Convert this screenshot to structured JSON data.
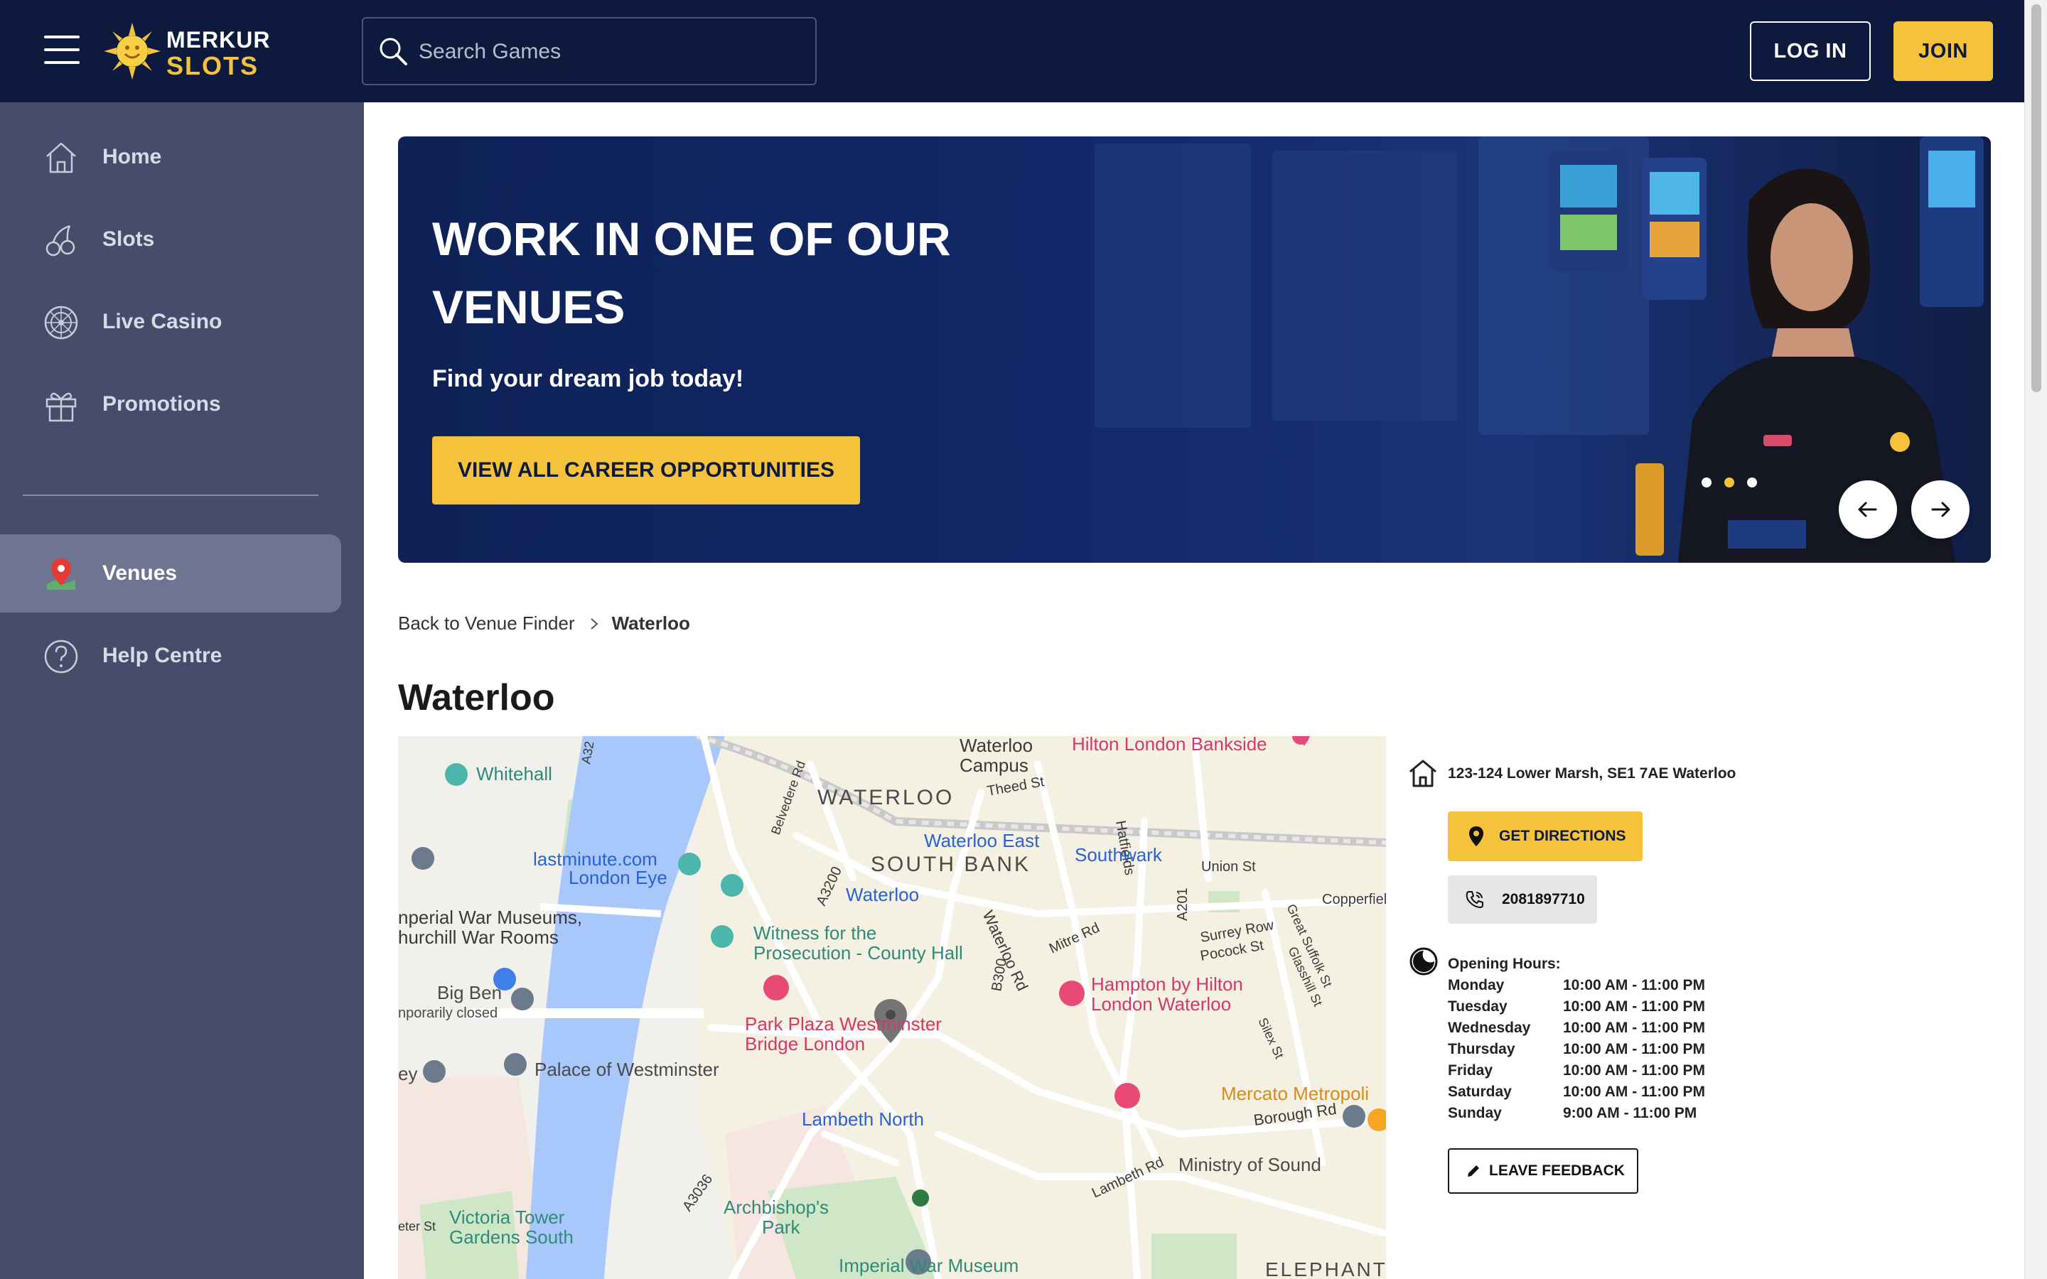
{
  "header": {
    "menu_icon": "hamburger-icon",
    "logo_line1": "MERKUR",
    "logo_line2": "SLOTS",
    "search_placeholder": "Search Games",
    "login_label": "LOG IN",
    "join_label": "JOIN"
  },
  "sidebar": {
    "items": [
      {
        "label": "Home",
        "icon": "home-icon"
      },
      {
        "label": "Slots",
        "icon": "cherries-icon"
      },
      {
        "label": "Live Casino",
        "icon": "roulette-wheel-icon"
      },
      {
        "label": "Promotions",
        "icon": "gift-icon"
      },
      {
        "label": "Venues",
        "icon": "map-pin-icon",
        "active": true
      },
      {
        "label": "Help Centre",
        "icon": "help-circle-icon"
      }
    ]
  },
  "banner": {
    "title_line1": "WORK IN ONE OF OUR",
    "title_line2": "VENUES",
    "subtitle": "Find your dream job today!",
    "cta_label": "VIEW ALL CAREER OPPORTUNITIES",
    "active_slide": 2,
    "slide_count": 3
  },
  "breadcrumb": {
    "back_label": "Back to Venue Finder",
    "current": "Waterloo"
  },
  "venue": {
    "title": "Waterloo",
    "address": "123-124 Lower Marsh, SE1 7AE Waterloo",
    "directions_label": "GET DIRECTIONS",
    "phone": "2081897710",
    "hours_title": "Opening Hours:",
    "hours": [
      {
        "day": "Monday",
        "time": "10:00 AM - 11:00 PM"
      },
      {
        "day": "Tuesday",
        "time": "10:00 AM - 11:00 PM"
      },
      {
        "day": "Wednesday",
        "time": "10:00 AM - 11:00 PM"
      },
      {
        "day": "Thursday",
        "time": "10:00 AM - 11:00 PM"
      },
      {
        "day": "Friday",
        "time": "10:00 AM - 11:00 PM"
      },
      {
        "day": "Saturday",
        "time": "10:00 AM - 11:00 PM"
      },
      {
        "day": "Sunday",
        "time": "9:00 AM - 11:00 PM"
      }
    ],
    "feedback_label": "LEAVE FEEDBACK"
  },
  "map": {
    "labels": {
      "waterloo_campus_1": "Waterloo",
      "waterloo_campus_2": "Campus",
      "hilton_bankside": "Hilton London Bankside",
      "whitehall": "Whitehall",
      "waterloo": "WATERLOO",
      "theed_st": "Theed St",
      "hatfields": "Hatfields",
      "waterloo_east": "Waterloo East",
      "southwark": "Southwark",
      "union_st": "Union St",
      "lastminute_1": "lastminute.com",
      "lastminute_2": "London Eye",
      "south_bank": "SOUTH BANK",
      "a3200": "A3200",
      "waterloo_station": "Waterloo",
      "a201": "A201",
      "copperfield": "Copperfiel",
      "iwm_1": "nperial War Museums,",
      "iwm_2": "hurchill War Rooms",
      "witness_1": "Witness for the",
      "witness_2": "Prosecution - County Hall",
      "mitre_rd": "Mitre Rd",
      "surrey_row": "Surrey Row",
      "pocock_st": "Pocock St",
      "great_suffolk": "Great Suffolk St",
      "glasshill": "Glasshill St",
      "waterloo_rd": "Waterloo Rd",
      "b300": "B300",
      "big_ben_1": "Big Ben",
      "big_ben_2": "nporarily closed",
      "hampton_1": "Hampton by Hilton",
      "hampton_2": "London Waterloo",
      "park_plaza_1": "Park Plaza Westminster",
      "park_plaza_2": "Bridge London",
      "silex_st": "Silex St",
      "palace": "Palace of Westminster",
      "ey": "ey",
      "mercato": "Mercato Metropoli",
      "borough_rd": "Borough Rd",
      "lambeth_north": "Lambeth North",
      "ministry": "Ministry of Sound",
      "lambeth_rd": "Lambeth Rd",
      "a3036": "A3036",
      "archbishop_1": "Archbishop's",
      "archbishop_2": "Park",
      "victoria_1": "Victoria Tower",
      "victoria_2": "Gardens South",
      "eter_st": "eter St",
      "iwm_south": "Imperial War Museum",
      "elephant": "ELEPHANT",
      "belvedere": "Belvedere Rd",
      "a32": "A32"
    }
  },
  "colors": {
    "navy": "#0d1a3e",
    "sidebar": "#454d6b",
    "accent_yellow": "#f5c33b",
    "thames": "#a8c7fa"
  }
}
